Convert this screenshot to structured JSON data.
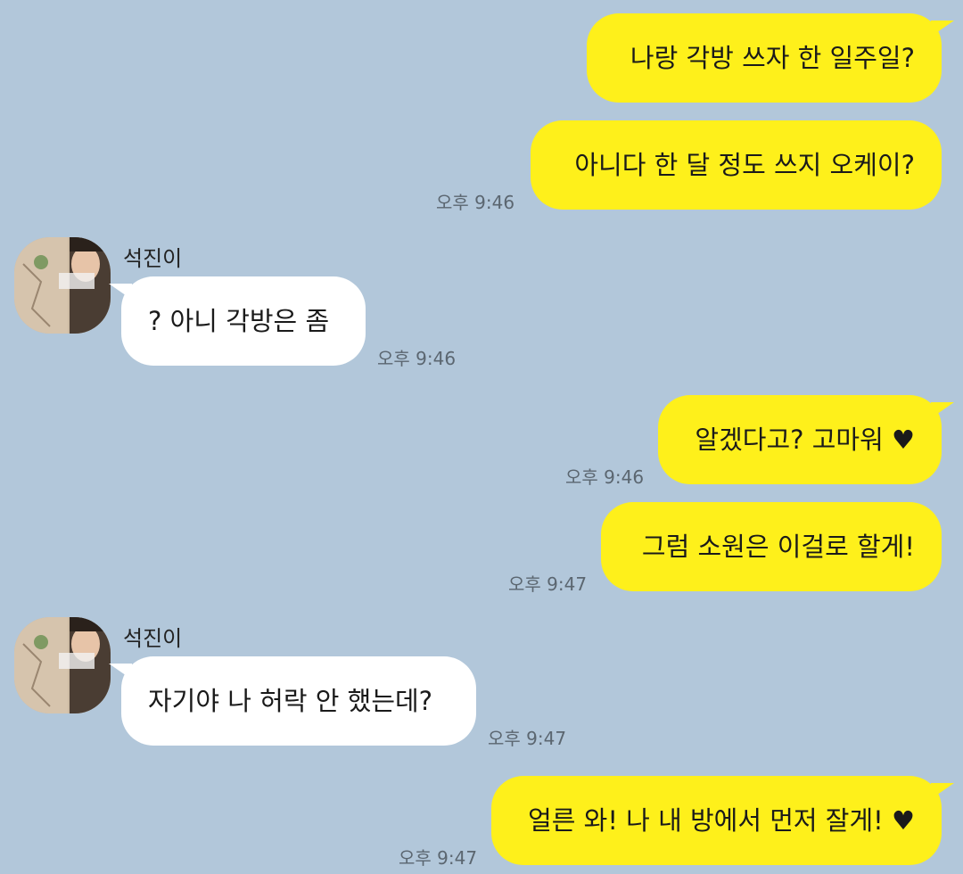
{
  "contact": {
    "name": "석진이"
  },
  "messages": [
    {
      "from": "me",
      "text": "나랑 각방 쓰자 한 일주일?",
      "time": ""
    },
    {
      "from": "me",
      "text": "아니다 한 달 정도 쓰지 오케이?",
      "time": "오후 9:46"
    },
    {
      "from": "them",
      "text": "? 아니 각방은 좀",
      "time": "오후 9:46"
    },
    {
      "from": "me",
      "text": "알겠다고? 고마워 ♥",
      "time": "오후 9:46"
    },
    {
      "from": "me",
      "text": "그럼 소원은 이걸로 할게!",
      "time": "오후 9:47"
    },
    {
      "from": "them",
      "text": "자기야 나 허락 안 했는데?",
      "time": "오후 9:47"
    },
    {
      "from": "me",
      "text": "얼른 와! 나 내 방에서 먼저 잘게! ♥",
      "time": "오후 9:47"
    }
  ],
  "colors": {
    "background": "#b2c7da",
    "my_bubble": "#fef01b",
    "their_bubble": "#ffffff",
    "timestamp": "#5b6670"
  },
  "icons": {
    "avatar": "profile-photo"
  }
}
